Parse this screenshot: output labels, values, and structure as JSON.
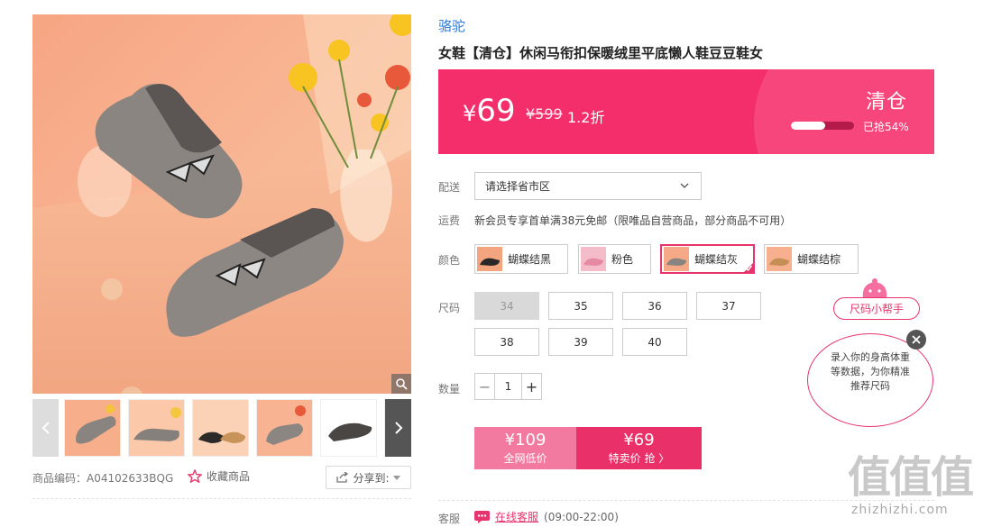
{
  "gallery": {
    "thumbnail_count": 6
  },
  "meta": {
    "sku_label": "商品编码：",
    "sku_value": "A04102633BQG",
    "favorite_label": "收藏商品",
    "share_label": "分享到:"
  },
  "product": {
    "brand": "骆驼",
    "title": "女鞋【清仓】休闲马衔扣保暖绒里平底懒人鞋豆豆鞋女"
  },
  "price_banner": {
    "currency": "¥",
    "price": "69",
    "original_price": "¥599",
    "discount": "1.2折",
    "tag": "清仓",
    "sold_text": "已抢54%",
    "sold_fraction": 0.54,
    "color": "#f42e6b"
  },
  "delivery": {
    "label": "配送",
    "placeholder": "请选择省市区"
  },
  "shipping": {
    "label": "运费",
    "text": "新会员专享首单满38元免邮（限唯品自营商品，部分商品不可用）"
  },
  "colors": {
    "label": "颜色",
    "options": [
      {
        "name": "蝴蝶结黑",
        "selected": false
      },
      {
        "name": "粉色",
        "selected": false
      },
      {
        "name": "蝴蝶结灰",
        "selected": true
      },
      {
        "name": "蝴蝶结棕",
        "selected": false
      }
    ]
  },
  "sizes": {
    "label": "尺码",
    "options": [
      {
        "value": "34",
        "available": false
      },
      {
        "value": "35",
        "available": true
      },
      {
        "value": "36",
        "available": true
      },
      {
        "value": "37",
        "available": true
      },
      {
        "value": "38",
        "available": true
      },
      {
        "value": "39",
        "available": true
      },
      {
        "value": "40",
        "available": true
      }
    ]
  },
  "quantity": {
    "label": "数量",
    "value": "1",
    "minus": "−",
    "plus": "+"
  },
  "buy": {
    "market_price": "¥109",
    "market_label": "全网低价",
    "special_price": "¥69",
    "special_label": "特卖价 抢 〉"
  },
  "service": {
    "label": "客服",
    "link": "在线客服",
    "hours": "(09:00-22:00)"
  },
  "size_helper": {
    "title": "尺码小帮手",
    "tip": "录入你的身高体重等数据，为你精准推荐尺码"
  },
  "watermark": {
    "big": "值值值",
    "small": "zhizhizhi.com"
  }
}
